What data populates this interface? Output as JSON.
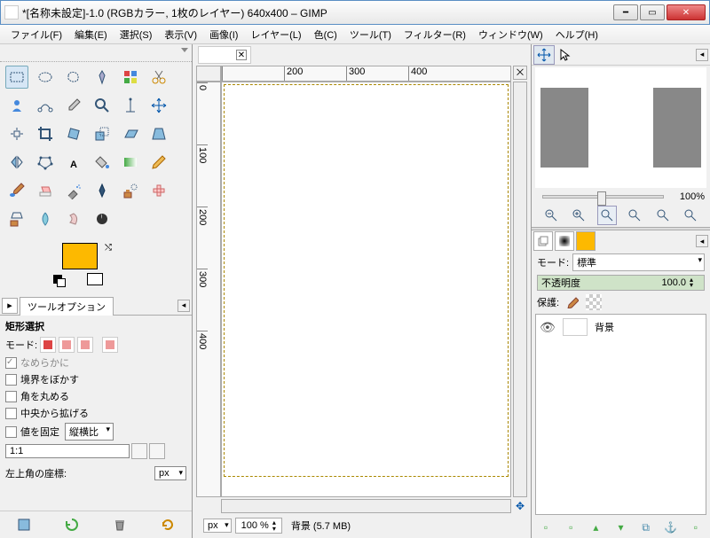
{
  "window": {
    "title": "*[名称未設定]-1.0 (RGBカラー, 1枚のレイヤー) 640x400 – GIMP"
  },
  "menus": {
    "file": "ファイル(F)",
    "edit": "編集(E)",
    "select": "選択(S)",
    "view": "表示(V)",
    "image": "画像(I)",
    "layer": "レイヤー(L)",
    "color": "色(C)",
    "tools": "ツール(T)",
    "filter": "フィルター(R)",
    "window": "ウィンドウ(W)",
    "help": "ヘルプ(H)"
  },
  "tool_options": {
    "tab_label": "ツールオプション",
    "title": "矩形選択",
    "mode_label": "モード:",
    "antialias": "なめらかに",
    "feather": "境界をぼかす",
    "round": "角を丸める",
    "expand": "中央から拡げる",
    "fixed": "値を固定",
    "fixed_combo": "縦横比",
    "ratio": "1:1",
    "corner_label": "左上角の座標:",
    "unit": "px"
  },
  "status": {
    "unit": "px",
    "zoom": "100 %",
    "layer_info": "背景 (5.7 MB)"
  },
  "navigator": {
    "zoom_label": "100%"
  },
  "layers": {
    "mode_label": "モード:",
    "mode_value": "標準",
    "opacity_label": "不透明度",
    "opacity_value": "100.0",
    "lock_label": "保護:",
    "bg_layer": "背景"
  },
  "ruler_h": [
    "",
    "200",
    "300",
    "400"
  ],
  "ruler_v": [
    "0",
    "100",
    "200",
    "300",
    "400"
  ]
}
